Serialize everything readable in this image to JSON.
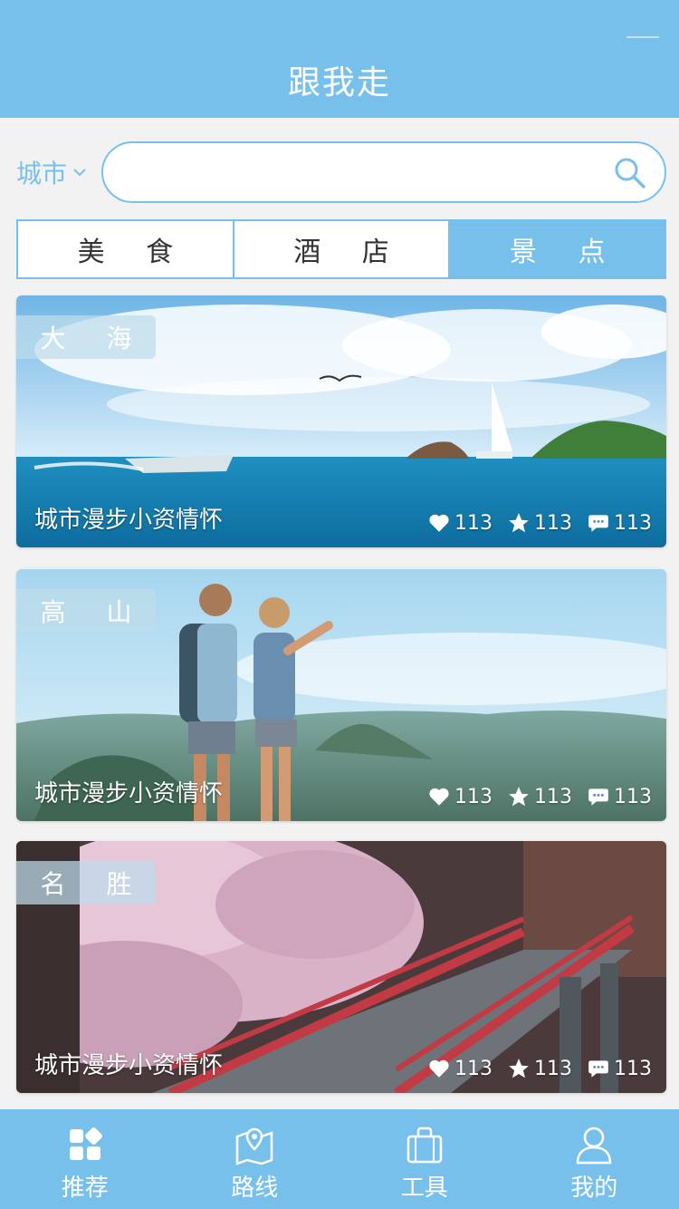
{
  "header": {
    "title": "跟我走"
  },
  "search": {
    "city_label": "城市",
    "placeholder": "",
    "value": ""
  },
  "tabs": [
    {
      "label": "美 食",
      "active": false
    },
    {
      "label": "酒 店",
      "active": false
    },
    {
      "label": "景 点",
      "active": true
    }
  ],
  "cards": [
    {
      "tag": "大 海",
      "caption": "城市漫步小资情怀",
      "likes": "113",
      "favorites": "113",
      "comments": "113"
    },
    {
      "tag": "高 山",
      "caption": "城市漫步小资情怀",
      "likes": "113",
      "favorites": "113",
      "comments": "113"
    },
    {
      "tag": "名 胜",
      "caption": "城市漫步小资情怀",
      "likes": "113",
      "favorites": "113",
      "comments": "113"
    }
  ],
  "bottom_nav": [
    {
      "label": "推荐",
      "icon": "grid-icon"
    },
    {
      "label": "路线",
      "icon": "map-pin-icon"
    },
    {
      "label": "工具",
      "icon": "bag-icon"
    },
    {
      "label": "我的",
      "icon": "user-icon"
    }
  ],
  "colors": {
    "accent": "#78c0ec",
    "background": "#f2f2f2"
  }
}
